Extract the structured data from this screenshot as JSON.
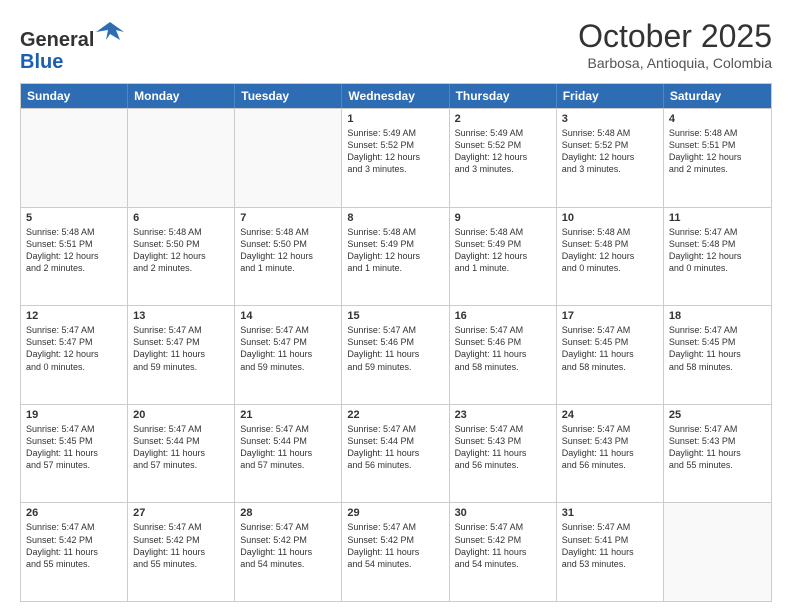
{
  "logo": {
    "general": "General",
    "blue": "Blue"
  },
  "header": {
    "month": "October 2025",
    "location": "Barbosa, Antioquia, Colombia"
  },
  "weekdays": [
    "Sunday",
    "Monday",
    "Tuesday",
    "Wednesday",
    "Thursday",
    "Friday",
    "Saturday"
  ],
  "rows": [
    [
      {
        "day": "",
        "text": "",
        "empty": true
      },
      {
        "day": "",
        "text": "",
        "empty": true
      },
      {
        "day": "",
        "text": "",
        "empty": true
      },
      {
        "day": "1",
        "text": "Sunrise: 5:49 AM\nSunset: 5:52 PM\nDaylight: 12 hours\nand 3 minutes."
      },
      {
        "day": "2",
        "text": "Sunrise: 5:49 AM\nSunset: 5:52 PM\nDaylight: 12 hours\nand 3 minutes."
      },
      {
        "day": "3",
        "text": "Sunrise: 5:48 AM\nSunset: 5:52 PM\nDaylight: 12 hours\nand 3 minutes."
      },
      {
        "day": "4",
        "text": "Sunrise: 5:48 AM\nSunset: 5:51 PM\nDaylight: 12 hours\nand 2 minutes."
      }
    ],
    [
      {
        "day": "5",
        "text": "Sunrise: 5:48 AM\nSunset: 5:51 PM\nDaylight: 12 hours\nand 2 minutes."
      },
      {
        "day": "6",
        "text": "Sunrise: 5:48 AM\nSunset: 5:50 PM\nDaylight: 12 hours\nand 2 minutes."
      },
      {
        "day": "7",
        "text": "Sunrise: 5:48 AM\nSunset: 5:50 PM\nDaylight: 12 hours\nand 1 minute."
      },
      {
        "day": "8",
        "text": "Sunrise: 5:48 AM\nSunset: 5:49 PM\nDaylight: 12 hours\nand 1 minute."
      },
      {
        "day": "9",
        "text": "Sunrise: 5:48 AM\nSunset: 5:49 PM\nDaylight: 12 hours\nand 1 minute."
      },
      {
        "day": "10",
        "text": "Sunrise: 5:48 AM\nSunset: 5:48 PM\nDaylight: 12 hours\nand 0 minutes."
      },
      {
        "day": "11",
        "text": "Sunrise: 5:47 AM\nSunset: 5:48 PM\nDaylight: 12 hours\nand 0 minutes."
      }
    ],
    [
      {
        "day": "12",
        "text": "Sunrise: 5:47 AM\nSunset: 5:47 PM\nDaylight: 12 hours\nand 0 minutes."
      },
      {
        "day": "13",
        "text": "Sunrise: 5:47 AM\nSunset: 5:47 PM\nDaylight: 11 hours\nand 59 minutes."
      },
      {
        "day": "14",
        "text": "Sunrise: 5:47 AM\nSunset: 5:47 PM\nDaylight: 11 hours\nand 59 minutes."
      },
      {
        "day": "15",
        "text": "Sunrise: 5:47 AM\nSunset: 5:46 PM\nDaylight: 11 hours\nand 59 minutes."
      },
      {
        "day": "16",
        "text": "Sunrise: 5:47 AM\nSunset: 5:46 PM\nDaylight: 11 hours\nand 58 minutes."
      },
      {
        "day": "17",
        "text": "Sunrise: 5:47 AM\nSunset: 5:45 PM\nDaylight: 11 hours\nand 58 minutes."
      },
      {
        "day": "18",
        "text": "Sunrise: 5:47 AM\nSunset: 5:45 PM\nDaylight: 11 hours\nand 58 minutes."
      }
    ],
    [
      {
        "day": "19",
        "text": "Sunrise: 5:47 AM\nSunset: 5:45 PM\nDaylight: 11 hours\nand 57 minutes."
      },
      {
        "day": "20",
        "text": "Sunrise: 5:47 AM\nSunset: 5:44 PM\nDaylight: 11 hours\nand 57 minutes."
      },
      {
        "day": "21",
        "text": "Sunrise: 5:47 AM\nSunset: 5:44 PM\nDaylight: 11 hours\nand 57 minutes."
      },
      {
        "day": "22",
        "text": "Sunrise: 5:47 AM\nSunset: 5:44 PM\nDaylight: 11 hours\nand 56 minutes."
      },
      {
        "day": "23",
        "text": "Sunrise: 5:47 AM\nSunset: 5:43 PM\nDaylight: 11 hours\nand 56 minutes."
      },
      {
        "day": "24",
        "text": "Sunrise: 5:47 AM\nSunset: 5:43 PM\nDaylight: 11 hours\nand 56 minutes."
      },
      {
        "day": "25",
        "text": "Sunrise: 5:47 AM\nSunset: 5:43 PM\nDaylight: 11 hours\nand 55 minutes."
      }
    ],
    [
      {
        "day": "26",
        "text": "Sunrise: 5:47 AM\nSunset: 5:42 PM\nDaylight: 11 hours\nand 55 minutes."
      },
      {
        "day": "27",
        "text": "Sunrise: 5:47 AM\nSunset: 5:42 PM\nDaylight: 11 hours\nand 55 minutes."
      },
      {
        "day": "28",
        "text": "Sunrise: 5:47 AM\nSunset: 5:42 PM\nDaylight: 11 hours\nand 54 minutes."
      },
      {
        "day": "29",
        "text": "Sunrise: 5:47 AM\nSunset: 5:42 PM\nDaylight: 11 hours\nand 54 minutes."
      },
      {
        "day": "30",
        "text": "Sunrise: 5:47 AM\nSunset: 5:42 PM\nDaylight: 11 hours\nand 54 minutes."
      },
      {
        "day": "31",
        "text": "Sunrise: 5:47 AM\nSunset: 5:41 PM\nDaylight: 11 hours\nand 53 minutes."
      },
      {
        "day": "",
        "text": "",
        "empty": true
      }
    ]
  ]
}
